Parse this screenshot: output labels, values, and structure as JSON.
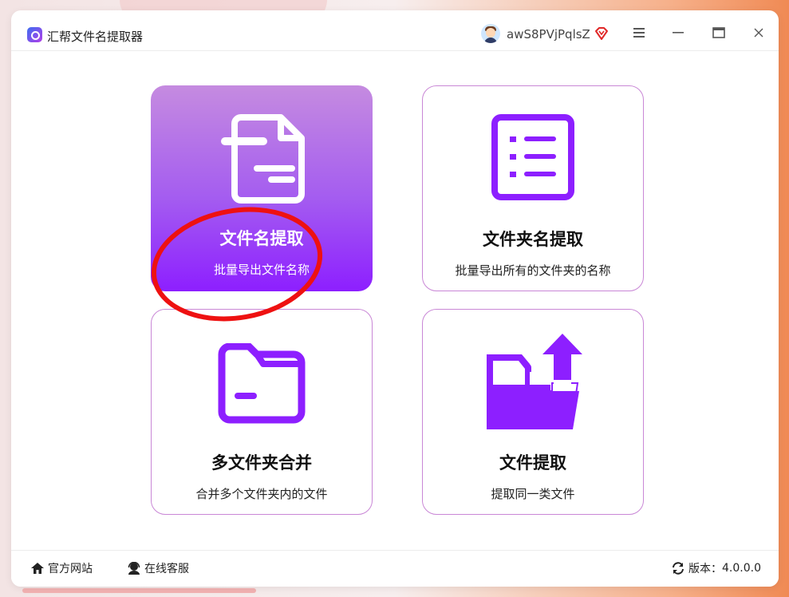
{
  "app": {
    "title": "汇帮文件名提取器",
    "username": "awS8PVjPqlsZ"
  },
  "cards": [
    {
      "title": "文件名提取",
      "desc": "批量导出文件名称",
      "icon": "file-document-icon",
      "active": true
    },
    {
      "title": "文件夹名提取",
      "desc": "批量导出所有的文件夹的名称",
      "icon": "list-icon",
      "active": false
    },
    {
      "title": "多文件夹合并",
      "desc": "合并多个文件夹内的文件",
      "icon": "folder-icon",
      "active": false
    },
    {
      "title": "文件提取",
      "desc": "提取同一类文件",
      "icon": "folder-upload-icon",
      "active": false
    }
  ],
  "footer": {
    "website": "官方网站",
    "service": "在线客服",
    "version_label": "版本：",
    "version": "4.0.0.0"
  },
  "colors": {
    "accent": "#8d1fff",
    "card_border": "#c987d6",
    "annotation": "#ee1111"
  }
}
